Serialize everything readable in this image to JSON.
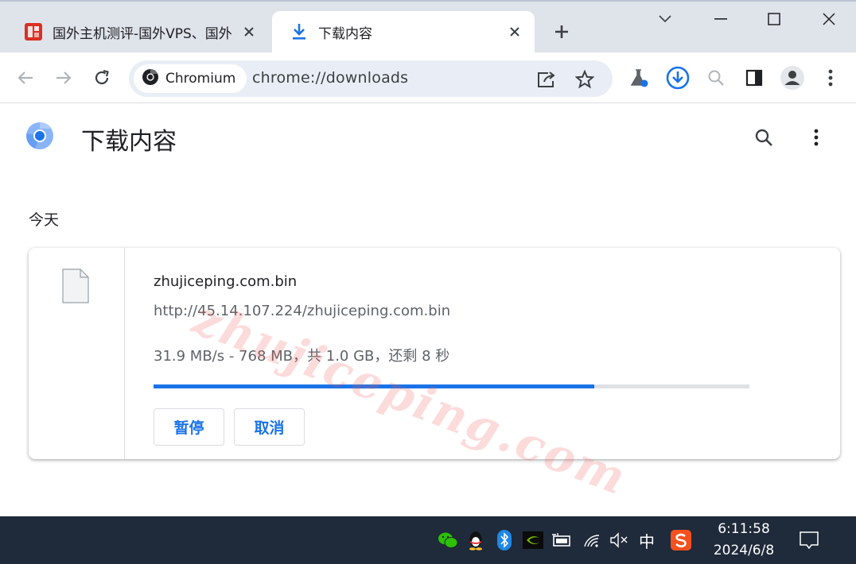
{
  "tabs": [
    {
      "title": "国外主机测评-国外VPS、国外",
      "favicon": "site-seal-icon",
      "active": false
    },
    {
      "title": "下载内容",
      "favicon": "download-icon",
      "active": true
    }
  ],
  "omnibox": {
    "chip_label": "Chromium",
    "url": "chrome://downloads"
  },
  "page": {
    "title": "下载内容",
    "section_date": "今天"
  },
  "download": {
    "file_name": "zhujiceping.com.bin",
    "file_url": "http://45.14.107.224/zhujiceping.com.bin",
    "status": "31.9 MB/s - 768 MB，共 1.0 GB，还剩 8 秒",
    "progress_fraction": 0.74,
    "pause_label": "暂停",
    "cancel_label": "取消"
  },
  "watermark": "zhujiceping.com",
  "taskbar": {
    "ime_label": "中",
    "time": "6:11:58",
    "date": "2024/6/8"
  },
  "colors": {
    "accent": "#1a73e8",
    "tabstrip": "#dfe3ea",
    "taskbar": "#1f2a3a"
  }
}
